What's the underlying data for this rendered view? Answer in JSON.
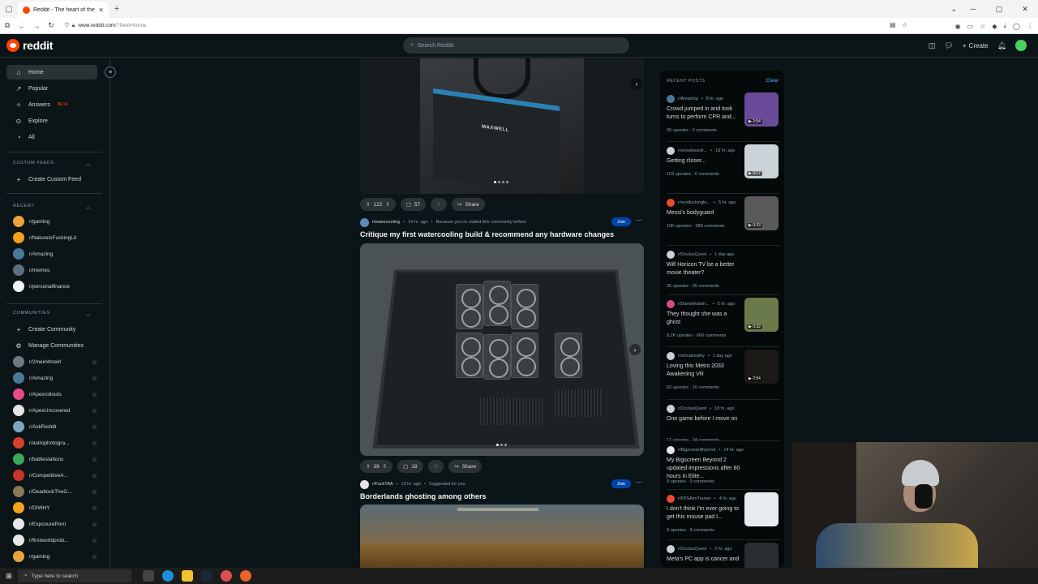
{
  "browser": {
    "tab_title": "Reddit - The heart of the intern",
    "url_host": "www.reddit.com",
    "url_path": "/?feed=home"
  },
  "header": {
    "logo_text": "reddit",
    "search_placeholder": "Search Reddit",
    "create_label": "Create"
  },
  "sidebar": {
    "nav": [
      {
        "label": "Home",
        "icon": "home-icon"
      },
      {
        "label": "Popular",
        "icon": "popular-icon"
      },
      {
        "label": "Answers",
        "icon": "answers-icon",
        "badge": "BETA"
      },
      {
        "label": "Explore",
        "icon": "explore-icon"
      },
      {
        "label": "All",
        "icon": "all-icon"
      }
    ],
    "custom_feeds_heading": "CUSTOM FEEDS",
    "create_custom_feed": "Create Custom Feed",
    "recent_heading": "RECENT",
    "recent": [
      {
        "name": "r/gaming",
        "color": "#e8a33c"
      },
      {
        "name": "r/NatureIsFuckingLit",
        "color": "#f59e1d"
      },
      {
        "name": "r/Amazing",
        "color": "#4a7a9a"
      },
      {
        "name": "r/memes",
        "color": "#5a7080"
      },
      {
        "name": "r/personalfinance",
        "color": "#f2f4f5"
      }
    ],
    "communities_heading": "COMMUNITIES",
    "create_community": "Create Community",
    "manage_communities": "Manage Communities",
    "communities": [
      {
        "name": "r/2meirl4meirl",
        "color": "#6a7b84"
      },
      {
        "name": "r/Amazing",
        "color": "#4a7a9a"
      },
      {
        "name": "r/Apexrollouts",
        "color": "#e84a8a"
      },
      {
        "name": "r/ApexUncovered",
        "color": "#e6e6e6"
      },
      {
        "name": "r/AskReddit",
        "color": "#7aa6c2"
      },
      {
        "name": "r/astrophotogra...",
        "color": "#d6402a"
      },
      {
        "name": "r/battlestations",
        "color": "#3aa85a"
      },
      {
        "name": "r/CompetitiveA...",
        "color": "#c8352a"
      },
      {
        "name": "r/DeadlockTheG...",
        "color": "#8a7a5a"
      },
      {
        "name": "r/DIWHY",
        "color": "#f2a31b"
      },
      {
        "name": "r/ExposurePorn",
        "color": "#e6e6e6"
      },
      {
        "name": "r/firstworldprob...",
        "color": "#e6e6e6"
      },
      {
        "name": "r/gaming",
        "color": "#e8a33c"
      }
    ]
  },
  "feed": {
    "post1": {
      "upvotes": "122",
      "comments": "57",
      "share": "Share"
    },
    "post2": {
      "subreddit": "r/watercooling",
      "time": "14 hr. ago",
      "reason": "Because you've visited this community before",
      "join": "Join",
      "title": "Critique my first watercooling build & recommend any hardware changes",
      "upvotes": "39",
      "comments": "18",
      "share": "Share"
    },
    "post3": {
      "subreddit": "r/FuckTAA",
      "time": "19 hr. ago",
      "reason": "Suggested for you",
      "join": "Join",
      "title": "Borderlands ghosting among others"
    },
    "box_text": "MAXWELL"
  },
  "recent_posts": {
    "heading": "RECENT POSTS",
    "clear": "Clear",
    "items": [
      {
        "sub": "r/Amazing",
        "time": "8 hr. ago",
        "title": "Crowd jumped in and took turns to perform CPR and...",
        "stats": "36 upvotes · 2 comments",
        "duration": "2:54",
        "thumb": "#6a4b9a"
      },
      {
        "sub": "r/snowboardi...",
        "time": "18 hr. ago",
        "title": "Getting closer...",
        "stats": "102 upvotes · 6 comments",
        "duration": "0:17",
        "thumb": "#c9d3d8"
      },
      {
        "sub": "r/nextfuckingle...",
        "time": "5 hr. ago",
        "title": "Messi's bodyguard",
        "stats": "19K upvotes · 588 comments",
        "duration": "0:33",
        "thumb": "#5a5a5a"
      },
      {
        "sub": "r/OculusQuest",
        "time": "1 day ago",
        "title": "Will Horizon TV be a better movie theater?",
        "stats": "35 upvotes · 35 comments"
      },
      {
        "sub": "r/Damnthatsin...",
        "time": "5 hr. ago",
        "title": "They thought she was a ghost",
        "stats": "8.2K upvotes · 660 comments",
        "duration": "0:32",
        "thumb": "#6b7a4a"
      },
      {
        "sub": "r/virtualreality",
        "time": "1 day ago",
        "title": "Loving this Metro 2033 Awakening VR",
        "stats": "62 upvotes · 16 comments",
        "duration": "2:54",
        "thumb": "#1c1a16"
      },
      {
        "sub": "r/OculusQuest",
        "time": "18 hr. ago",
        "title": "One game before I move on",
        "stats": "17 upvotes · 34 comments"
      },
      {
        "sub": "r/BigscreenBeyond",
        "time": "14 hr. ago",
        "title": "My Bigscreen Beyond 2 updated impressions after 60 hours in Elite...",
        "stats": "9 upvotes · 9 comments"
      },
      {
        "sub": "r/FPSAimTrainer",
        "time": "4 hr. ago",
        "title": "I don't think I'm ever going to get this mouse pad I...",
        "stats": "9 upvotes · 8 comments",
        "thumb": "#e8ecef"
      },
      {
        "sub": "r/OculusQuest",
        "time": "2 hr. ago",
        "title": "Meta's PC app is cancer and",
        "stats": "",
        "thumb": "#2a2e30"
      }
    ]
  },
  "taskbar": {
    "search_placeholder": "Type here to search"
  }
}
